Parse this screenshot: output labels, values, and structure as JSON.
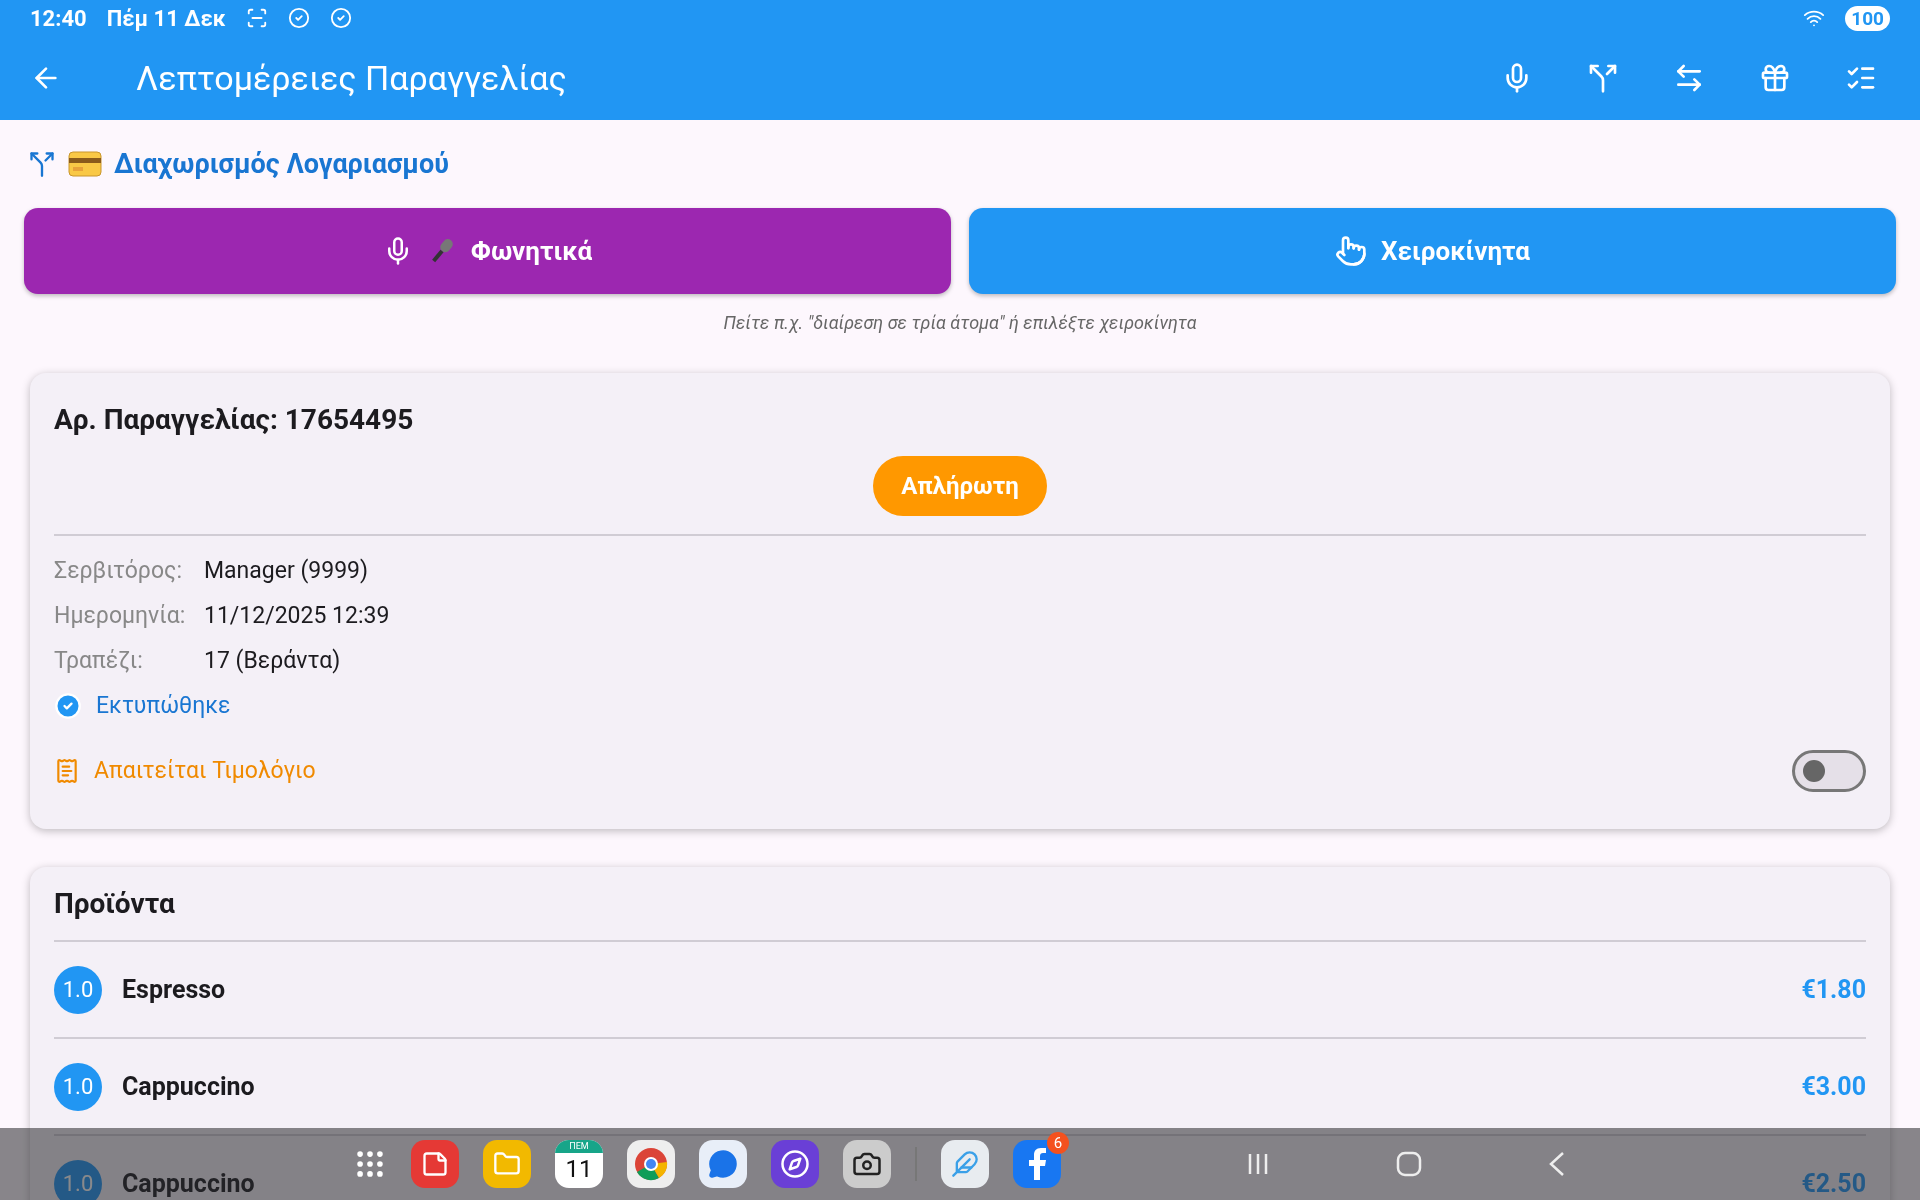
{
  "status_bar": {
    "time": "12:40",
    "date": "Πέμ 11 Δεκ",
    "battery": "100"
  },
  "app_bar": {
    "title": "Λεπτομέρειες Παραγγελίας"
  },
  "split": {
    "title": "Διαχωρισμός Λογαριασμού",
    "buttons": [
      {
        "label": "Φωνητικά",
        "kind": "voice"
      },
      {
        "label": "Χειροκίνητα",
        "kind": "manual"
      }
    ],
    "hint": "Πείτε π.χ. \"διαίρεση σε τρία άτομα\" ή επιλέξτε χειροκίνητα"
  },
  "order": {
    "title": "Αρ. Παραγγελίας: 17654495",
    "status": "Απλήρωτη",
    "fields": [
      {
        "label": "Σερβιτόρος:",
        "value": "Manager (9999)"
      },
      {
        "label": "Ημερομηνία:",
        "value": "11/12/2025 12:39"
      },
      {
        "label": "Τραπέζι:",
        "value": "17 (Βεράντα)"
      }
    ],
    "printed": {
      "label": "Εκτυπώθηκε",
      "checked": true
    },
    "invoice": {
      "label": "Απαιτείται Τιμολόγιο",
      "on": false
    }
  },
  "products": {
    "title": "Προϊόντα",
    "items": [
      {
        "qty": "1.0",
        "name": "Espresso",
        "price": "€1.80"
      },
      {
        "qty": "1.0",
        "name": "Cappuccino",
        "price": "€3.00"
      },
      {
        "qty": "1.0",
        "name": "Cappuccino",
        "price": "€2.50"
      }
    ]
  },
  "taskbar": {
    "calendar": {
      "weekday": "ΠΕΜ",
      "day": "11"
    },
    "badge": "6"
  }
}
